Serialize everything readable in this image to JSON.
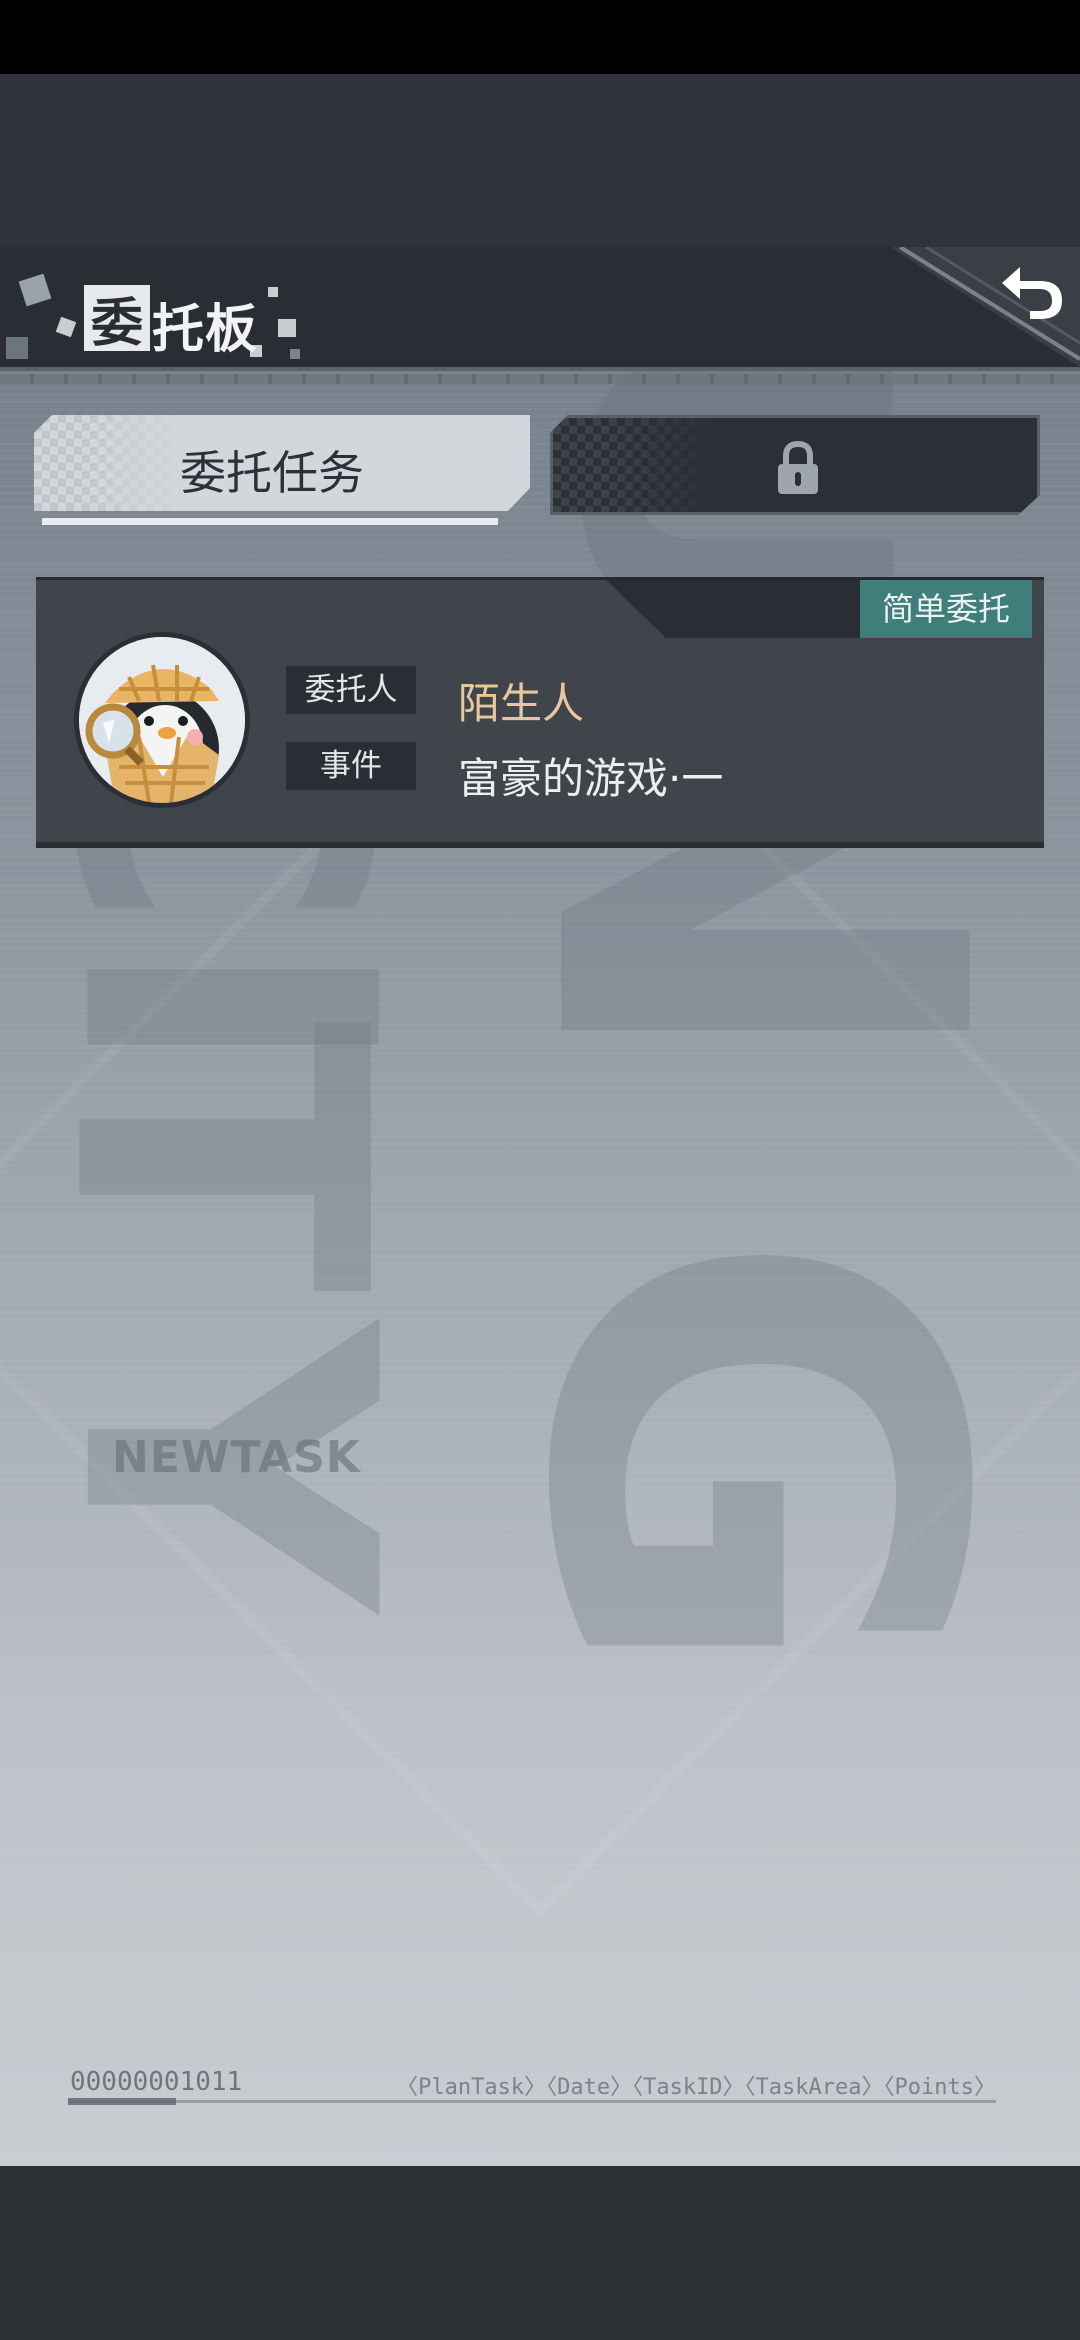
{
  "header": {
    "title_first_char": "委",
    "title_rest": "托板",
    "back_icon": "undo-arrow-icon"
  },
  "tabs": [
    {
      "label": "委托任务",
      "active": true
    },
    {
      "label": "",
      "locked": true,
      "icon": "lock-icon"
    }
  ],
  "task": {
    "difficulty": "简单委托",
    "client_label": "委托人",
    "client_value": "陌生人",
    "event_label": "事件",
    "event_value": "富豪的游戏·一",
    "avatar_icon": "detective-penguin-avatar"
  },
  "background": {
    "watermark": "NEWTASK",
    "serial": "00000001011",
    "footer_tags": "〈PlanTask〉〈Date〉〈TaskID〉〈TaskArea〉〈Points〉"
  },
  "colors": {
    "accent_teal": "#3f7e7a",
    "client_name": "#e9c79e",
    "panel_dark": "#2a2e34"
  }
}
